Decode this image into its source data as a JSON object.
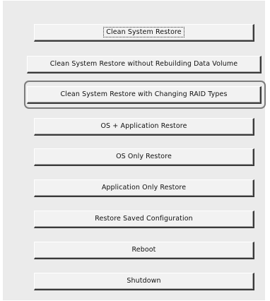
{
  "menu": {
    "items": [
      {
        "label": "Clean System Restore"
      },
      {
        "label": "Clean System Restore without Rebuilding Data Volume"
      },
      {
        "label": "Clean System Restore with Changing RAID Types"
      },
      {
        "label": "OS + Application Restore"
      },
      {
        "label": "OS Only Restore"
      },
      {
        "label": "Application Only Restore"
      },
      {
        "label": "Restore Saved Configuration"
      },
      {
        "label": "Reboot"
      },
      {
        "label": "Shutdown"
      }
    ]
  },
  "colors": {
    "panel_background": "#ebebeb",
    "button_face": "#f2f2f2",
    "highlight_ring": "#7c7c7c"
  }
}
